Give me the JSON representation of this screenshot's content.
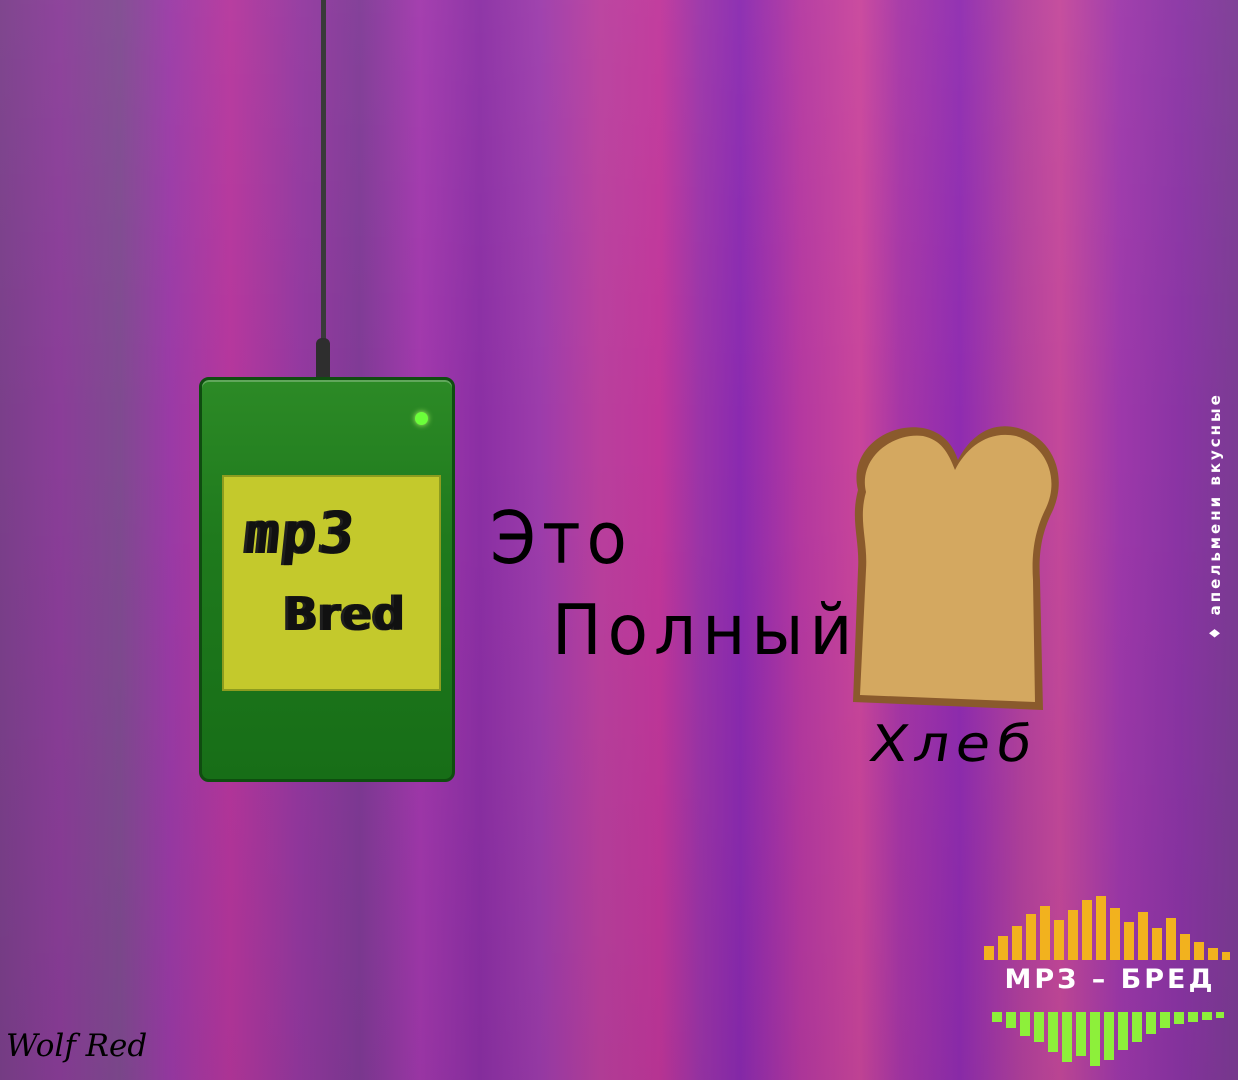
{
  "device": {
    "screen_line1": "mp3",
    "screen_line2": "Bred",
    "color": "#1f7a1d",
    "screen_color": "#c4c92c",
    "led_color": "#6bff3a"
  },
  "caption": {
    "line1": "Это",
    "line2": "Полный"
  },
  "bread": {
    "label": "Хлеб",
    "color": "#d4a860"
  },
  "side_text": "♦ апельмени вкусные",
  "logo": {
    "text": "МРЗ – БРЕД",
    "top_bar_color": "#f2b21e",
    "bottom_bar_color": "#8df03a"
  },
  "signature": "Wolf Red",
  "background": {
    "accent": "#a036aa"
  }
}
